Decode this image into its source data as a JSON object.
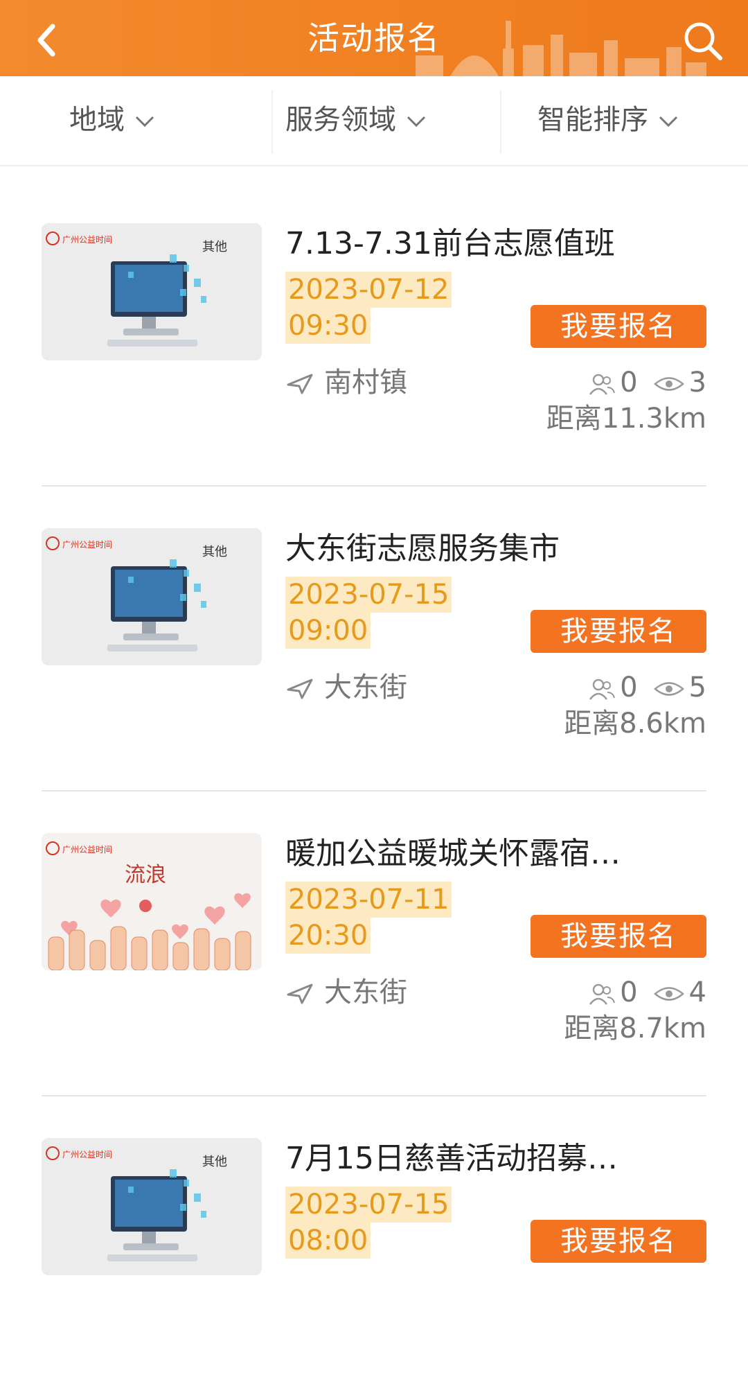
{
  "header": {
    "title": "活动报名",
    "back_icon": "back-chevron-icon",
    "search_icon": "search-icon",
    "color": "#f08022"
  },
  "filters": [
    {
      "label": "地域"
    },
    {
      "label": "服务领域"
    },
    {
      "label": "智能排序"
    }
  ],
  "activities": [
    {
      "title": "7.13-7.31前台志愿值班",
      "date": "2023-07-12",
      "time": "09:30",
      "signup_label": "我要报名",
      "location": "南村镇",
      "participants": "0",
      "views": "3",
      "distance": "距离11.3km",
      "thumb_brand": "广州公益时间",
      "thumb_caption": "其他"
    },
    {
      "title": "大东街志愿服务集市",
      "date": "2023-07-15",
      "time": "09:00",
      "signup_label": "我要报名",
      "location": "大东街",
      "participants": "0",
      "views": "5",
      "distance": "距离8.6km",
      "thumb_brand": "广州公益时间",
      "thumb_caption": "其他"
    },
    {
      "title": "暖加公益暖城关怀露宿…",
      "date": "2023-07-11",
      "time": "20:30",
      "signup_label": "我要报名",
      "location": "大东街",
      "participants": "0",
      "views": "4",
      "distance": "距离8.7km",
      "thumb_brand": "广州公益时间",
      "thumb_caption": "流浪"
    },
    {
      "title": "7月15日慈善活动招募…",
      "date": "2023-07-15",
      "time": "08:00",
      "signup_label": "我要报名",
      "location": "",
      "participants": "",
      "views": "",
      "distance": "",
      "thumb_brand": "广州公益时间",
      "thumb_caption": "其他"
    }
  ],
  "colors": {
    "accent": "#f37321",
    "date_bg": "#fde9c2",
    "date_text": "#e59a1c"
  }
}
